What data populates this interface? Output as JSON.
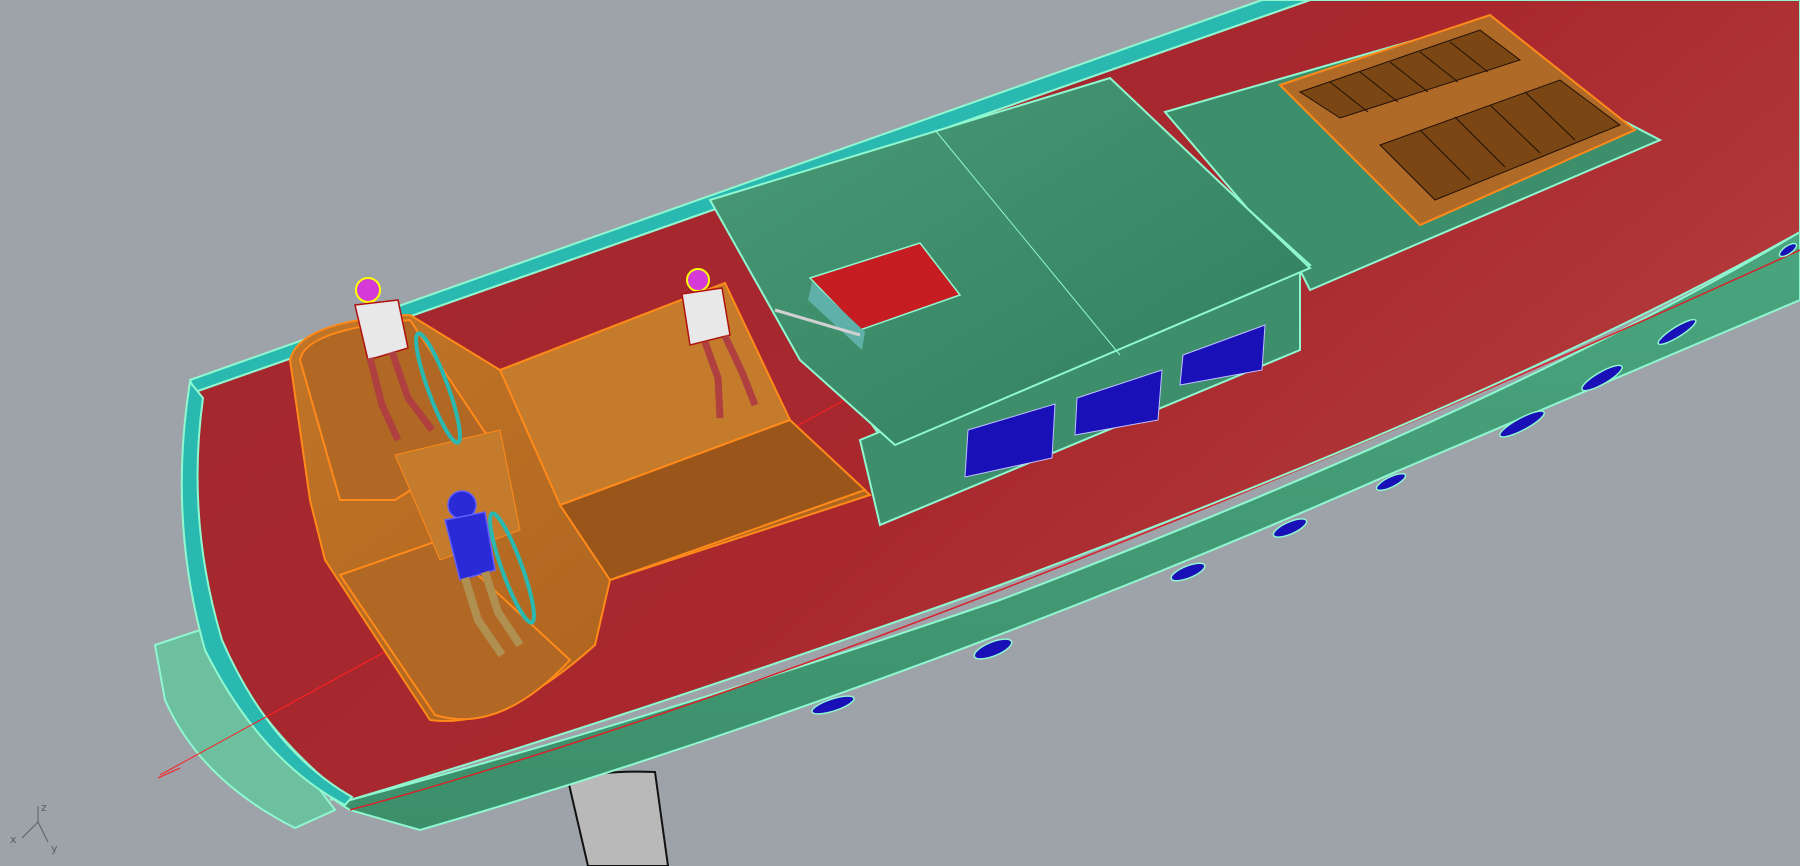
{
  "viewport": {
    "background": "#9ea2a9",
    "display_mode": "shaded"
  },
  "axis_triad": {
    "labels": {
      "x": "x",
      "y": "y",
      "z": "z"
    }
  },
  "model": {
    "parts": [
      "hull",
      "deck",
      "toerail",
      "coachroof",
      "deck-hatch",
      "cockpit",
      "helm-wheel-port",
      "helm-wheel-starboard",
      "transom-platform",
      "keel",
      "crew-figure-helm-port",
      "crew-figure-seated",
      "crew-figure-helm-starboard",
      "companionway",
      "portlight"
    ],
    "colors": {
      "hull": "#3f9a74",
      "hull_edge": "#7ff5c8",
      "deck": "#a0242a",
      "deck_highlight": "#b53a3f",
      "coachroof": "#3d8f6c",
      "cockpit": "#b86a22",
      "cockpit_edge": "#ff8a1a",
      "window": "#1a10b8",
      "toerail": "#2ab9b0",
      "keel": "#b9b9b9"
    },
    "hull_portlight_count": 9,
    "coachroof_window_count": 3
  }
}
